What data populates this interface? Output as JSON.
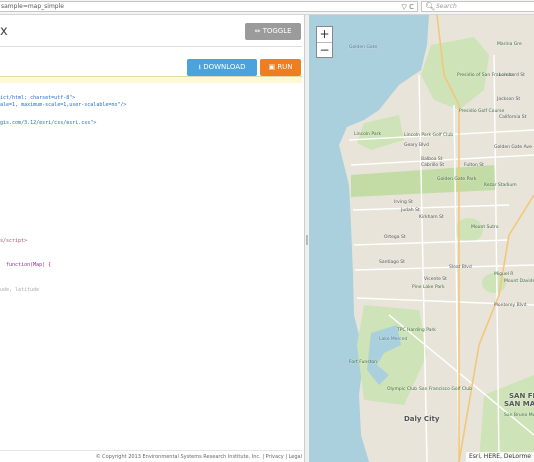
{
  "browser": {
    "url": "sample=map_simple",
    "search_placeholder": "Search",
    "reload_glyph": "▽ C"
  },
  "editor": {
    "title": "x",
    "toggle_label": "TOGGLE",
    "download_label": "DOWNLOAD",
    "run_label": "RUN",
    "code_lines": [
      {
        "text": "",
        "cls": "c-str"
      },
      {
        "text": "",
        "cls": "c-str"
      },
      {
        "text": "ict/html; charset=utf-8\">",
        "cls": "c-str"
      },
      {
        "text": "ale=1, maximum-scale=1,user-scalable=no\"/>",
        "cls": "c-str"
      },
      {
        "text": "",
        "cls": "c-str"
      },
      {
        "text": "",
        "cls": "c-str"
      },
      {
        "text": "gis.com/3.12/esri/css/esri.css\">",
        "cls": "c-str"
      },
      {
        "text": "",
        "cls": "c-str"
      },
      {
        "text": "",
        "cls": "c-str"
      },
      {
        "text": "",
        "cls": "c-str"
      },
      {
        "text": "",
        "cls": "c-str"
      },
      {
        "text": "",
        "cls": "c-str"
      },
      {
        "text": "",
        "cls": "c-str"
      },
      {
        "text": "",
        "cls": "c-str"
      },
      {
        "text": "",
        "cls": "c-str"
      },
      {
        "text": "",
        "cls": "c-str"
      },
      {
        "text": "",
        "cls": "c-str"
      },
      {
        "text": "",
        "cls": "c-str"
      },
      {
        "text": "",
        "cls": "c-str"
      },
      {
        "text": "",
        "cls": "c-str"
      },
      {
        "text": "",
        "cls": "c-str"
      },
      {
        "text": "",
        "cls": "c-str"
      },
      {
        "text": "",
        "cls": "c-str"
      },
      {
        "text": "",
        "cls": "c-str"
      },
      {
        "text": "",
        "cls": "c-str"
      },
      {
        "text": "s/script>",
        "cls": "c-tag"
      },
      {
        "text": "",
        "cls": "c-str"
      },
      {
        "text": "",
        "cls": "c-str"
      },
      {
        "text": "",
        "cls": "c-str"
      },
      {
        "text": "  function(Map) {",
        "cls": "c-kw"
      },
      {
        "text": "",
        "cls": "c-str"
      },
      {
        "text": "",
        "cls": "c-str"
      },
      {
        "text": "",
        "cls": "c-str"
      },
      {
        "text": "ude, latitude",
        "cls": "c-com"
      }
    ],
    "footer": "© Copyright 2013 Environmental Systems Research Institute, Inc. | Privacy | Legal"
  },
  "map": {
    "zoom_in": "+",
    "zoom_out": "−",
    "attribution": "Esri, HERE, DeLorme",
    "labels": [
      {
        "text": "Golden Gate",
        "kind": "water"
      },
      {
        "text": "Presidio of San Francisco",
        "kind": "area"
      },
      {
        "text": "Presidio Golf Course",
        "kind": "area"
      },
      {
        "text": "Lincoln Park Golf Club",
        "kind": "area"
      },
      {
        "text": "Lincoln Park",
        "kind": "area"
      },
      {
        "text": "Geary Blvd",
        "kind": "road"
      },
      {
        "text": "Balboa St",
        "kind": "road"
      },
      {
        "text": "Cabrillo St",
        "kind": "road"
      },
      {
        "text": "Fulton St",
        "kind": "road"
      },
      {
        "text": "Golden Gate Park",
        "kind": "area"
      },
      {
        "text": "Kezar Stadium",
        "kind": "area"
      },
      {
        "text": "Irving St",
        "kind": "road"
      },
      {
        "text": "Judah St",
        "kind": "road"
      },
      {
        "text": "Kirkham St",
        "kind": "road"
      },
      {
        "text": "Ortega St",
        "kind": "road"
      },
      {
        "text": "Mount Sutro",
        "kind": "area"
      },
      {
        "text": "Santiago St",
        "kind": "road"
      },
      {
        "text": "Sloat Blvd",
        "kind": "road"
      },
      {
        "text": "Pine Lake Park",
        "kind": "area"
      },
      {
        "text": "Monterey Blvd",
        "kind": "road"
      },
      {
        "text": "Mount Davidson",
        "kind": "area"
      },
      {
        "text": "Miguel R",
        "kind": "area"
      },
      {
        "text": "TPC Harding Park",
        "kind": "area"
      },
      {
        "text": "Lake Merced",
        "kind": "water"
      },
      {
        "text": "Fort Funston",
        "kind": "area"
      },
      {
        "text": "Olympic Club",
        "kind": "area"
      },
      {
        "text": "San Francisco Golf Club",
        "kind": "area"
      },
      {
        "text": "Daly City",
        "kind": "city"
      },
      {
        "text": "SAN FR",
        "kind": "city"
      },
      {
        "text": "SAN MATEO",
        "kind": "city"
      },
      {
        "text": "San Bruno Mountain State Park",
        "kind": "area"
      },
      {
        "text": "Vicente St",
        "kind": "road"
      },
      {
        "text": "Marina Gre",
        "kind": "area"
      },
      {
        "text": "Lombard St",
        "kind": "road"
      },
      {
        "text": "California St",
        "kind": "road"
      },
      {
        "text": "Jackson St",
        "kind": "road"
      },
      {
        "text": "Golden Gate Ave",
        "kind": "road"
      }
    ]
  }
}
